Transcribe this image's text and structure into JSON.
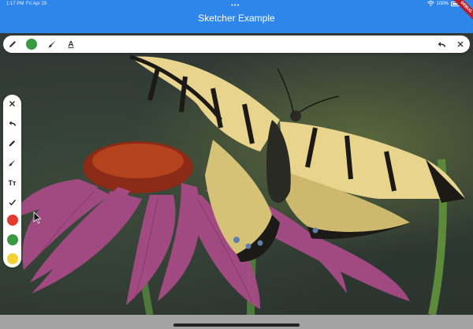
{
  "status_bar": {
    "time": "1:17 PM",
    "date": "Fri Apr 29",
    "battery": "100%",
    "dots": "•••"
  },
  "app_bar": {
    "title": "Sketcher Example",
    "debug_badge": "DEBUG"
  },
  "colors": {
    "app_bar": "#2f86ea",
    "green": "#3a9a3f",
    "red": "#e23b2e",
    "yellow": "#f4d234"
  },
  "toolbar_top": {
    "left_tools": [
      "pencil-icon",
      "color-swatch-green",
      "brush-icon",
      "text-format-icon"
    ],
    "right_tools": [
      "undo-icon",
      "close-icon"
    ],
    "text_format_glyph": "A"
  },
  "toolbar_left": {
    "tools": [
      "close-icon",
      "undo-icon",
      "pencil-icon",
      "brush-icon",
      "text-size-icon",
      "check-icon",
      "color-swatch-red",
      "color-swatch-green",
      "color-swatch-yellow"
    ],
    "text_size_glyph": "Tт"
  }
}
